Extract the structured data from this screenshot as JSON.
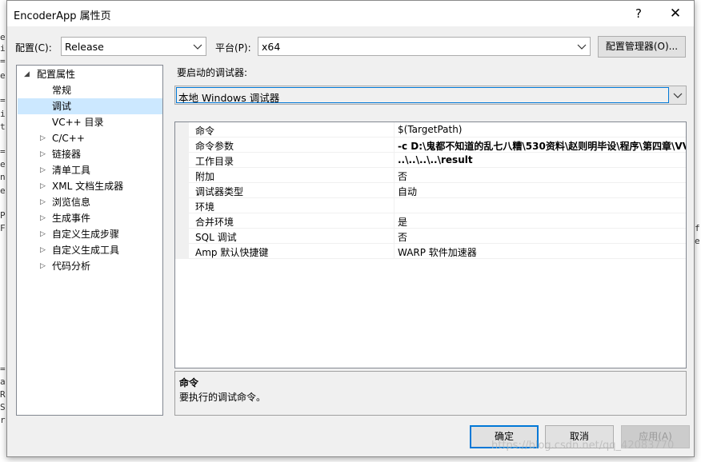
{
  "window": {
    "title": "EncoderApp 属性页",
    "help_glyph": "?",
    "close_glyph": "✕"
  },
  "toolbar": {
    "config_label": "配置(C):",
    "config_value": "Release",
    "platform_label": "平台(P):",
    "platform_value": "x64",
    "config_manager_button": "配置管理器(O)..."
  },
  "tree": {
    "items": [
      {
        "label": "配置属性",
        "expander": "◢"
      },
      {
        "label": "常规"
      },
      {
        "label": "调试",
        "selected": true
      },
      {
        "label": "VC++ 目录"
      },
      {
        "label": "C/C++",
        "expander": "▷"
      },
      {
        "label": "链接器",
        "expander": "▷"
      },
      {
        "label": "清单工具",
        "expander": "▷"
      },
      {
        "label": "XML 文档生成器",
        "expander": "▷"
      },
      {
        "label": "浏览信息",
        "expander": "▷"
      },
      {
        "label": "生成事件",
        "expander": "▷"
      },
      {
        "label": "自定义生成步骤",
        "expander": "▷"
      },
      {
        "label": "自定义生成工具",
        "expander": "▷"
      },
      {
        "label": "代码分析",
        "expander": "▷"
      }
    ]
  },
  "debugger": {
    "label": "要启动的调试器:",
    "value": "本地 Windows 调试器"
  },
  "properties": {
    "rows": [
      {
        "name": "命令",
        "value": "$(TargetPath)",
        "bold": false
      },
      {
        "name": "命令参数",
        "value": "-c D:\\鬼都不知道的乱七八糟\\530资料\\赵则明毕设\\程序\\第四章\\VV",
        "bold": true
      },
      {
        "name": "工作目录",
        "value": "..\\..\\..\\..\\result",
        "bold": true
      },
      {
        "name": "附加",
        "value": "否",
        "bold": false
      },
      {
        "name": "调试器类型",
        "value": "自动",
        "bold": false
      },
      {
        "name": "环境",
        "value": "",
        "bold": false
      },
      {
        "name": "合并环境",
        "value": "是",
        "bold": false
      },
      {
        "name": "SQL 调试",
        "value": "否",
        "bold": false
      },
      {
        "name": "Amp 默认快捷键",
        "value": "WARP 软件加速器",
        "bold": false
      }
    ]
  },
  "description": {
    "title": "命令",
    "text": "要执行的调试命令。"
  },
  "buttons": {
    "ok": "确定",
    "cancel": "取消",
    "apply": "应用(A)"
  },
  "background_left": [
    "e",
    "i",
    "=",
    "e",
    "=",
    "i",
    "t",
    "=",
    "e",
    "n",
    "e",
    "P",
    "F",
    "=",
    "a",
    "R",
    "S",
    "r"
  ],
  "background_right": [
    "f",
    "e"
  ],
  "watermark": "https://blog.csdn.net/qq_42083770"
}
